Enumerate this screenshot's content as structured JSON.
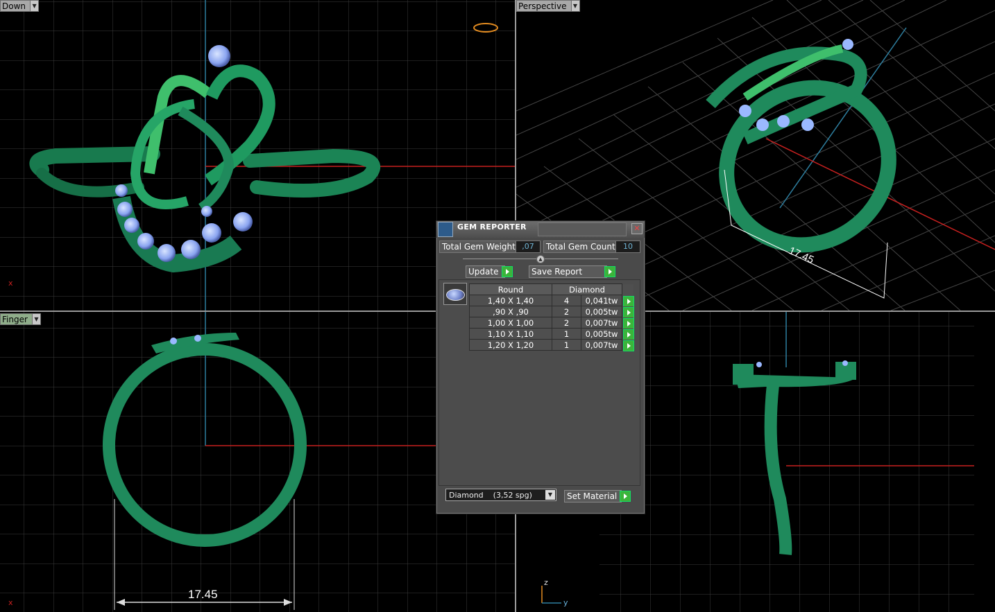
{
  "viewports": {
    "top_left": {
      "label": "Down"
    },
    "top_right": {
      "label": "Perspective"
    },
    "bottom_left": {
      "label": "Finger",
      "dimension": "17.45"
    },
    "bottom_right": {
      "label": ""
    },
    "perspective_dimension": "17.45"
  },
  "axis_labels": {
    "z": "z",
    "y": "y",
    "x": "x"
  },
  "gem_reporter": {
    "title": "GEM REPORTER",
    "total_weight_label": "Total Gem Weight",
    "total_weight_value": ",07",
    "total_count_label": "Total Gem Count",
    "total_count_value": "10",
    "update_label": "Update",
    "save_label": "Save Report",
    "table_headers": [
      "Round",
      "Diamond"
    ],
    "rows": [
      {
        "size": "1,40 X 1,40",
        "count": "4",
        "weight": "0,041tw"
      },
      {
        "size": ",90 X ,90",
        "count": "2",
        "weight": "0,005tw"
      },
      {
        "size": "1,00 X 1,00",
        "count": "2",
        "weight": "0,007tw"
      },
      {
        "size": "1,10 X 1,10",
        "count": "1",
        "weight": "0,005tw"
      },
      {
        "size": "1,20 X 1,20",
        "count": "1",
        "weight": "0,007tw"
      }
    ],
    "material_select": "Diamond    (3,52 spg)",
    "set_material_label": "Set Material"
  },
  "colors": {
    "grid": "#3c3c3c",
    "axis_red": "#c8201f",
    "axis_blue": "#2e7fa0",
    "ring_green": "#1f8a5c",
    "gem_blue": "#9ab8ff"
  }
}
